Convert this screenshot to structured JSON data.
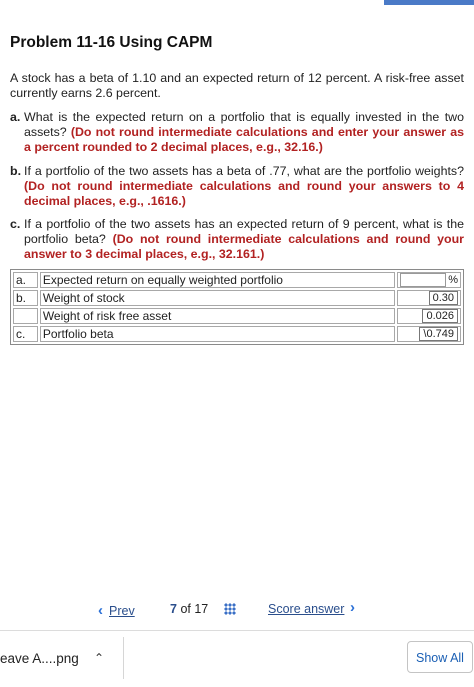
{
  "title": "Problem 11-16 Using CAPM",
  "intro": "A stock has a beta of 1.10 and an expected return of 12 percent. A risk-free asset currently earns 2.6 percent.",
  "questions": [
    {
      "letter": "a.",
      "text": "What is the expected return on a portfolio that is equally invested in the two assets?",
      "note": "(Do not round intermediate calculations and enter your answer as a percent rounded to 2 decimal places, e.g., 32.16.)"
    },
    {
      "letter": "b.",
      "text": "If a portfolio of the two assets has a beta of .77, what are the portfolio weights?",
      "note": "(Do not round intermediate calculations and round your answers to 4 decimal places, e.g., .1616.)"
    },
    {
      "letter": "c.",
      "text": "If a portfolio of the two assets has an expected return of 9 percent, what is the portfolio beta?",
      "note": "(Do not round intermediate calculations and round your answer to 3 decimal places, e.g., 32.161.)"
    }
  ],
  "answers": [
    {
      "label": "a.",
      "desc": "Expected return on equally weighted portfolio",
      "value": "",
      "unit": "%"
    },
    {
      "label": "b.",
      "desc": "Weight of stock",
      "value": "0.30"
    },
    {
      "label": "",
      "desc": "Weight of risk free asset",
      "value": "0.026"
    },
    {
      "label": "c.",
      "desc": "Portfolio beta",
      "value": "\\0.749"
    }
  ],
  "pager": {
    "prev": "Prev",
    "current": "7",
    "of": "of",
    "total": "17",
    "score": "Score answer"
  },
  "downloads": {
    "file": "eave A....png",
    "show_all": "Show All"
  }
}
